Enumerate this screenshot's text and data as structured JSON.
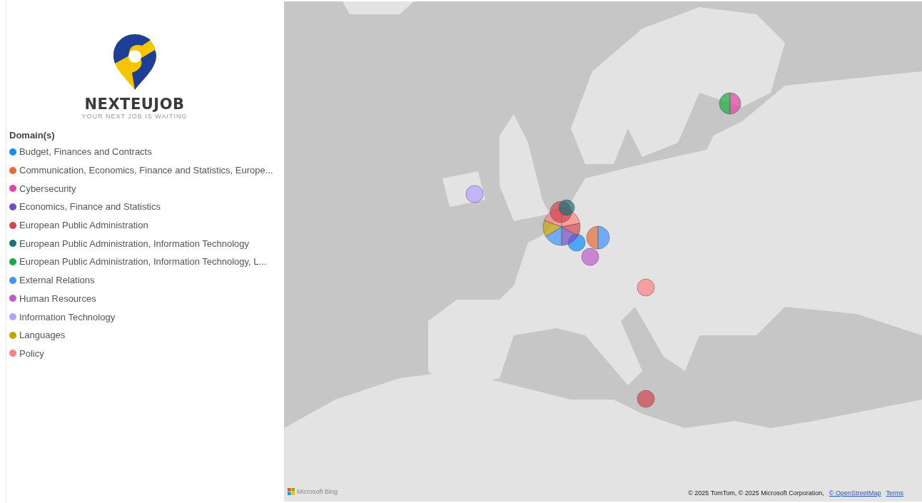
{
  "logo": {
    "name": "NEXTEUJOB",
    "tagline": "YOUR NEXT JOB IS WAITING"
  },
  "legend": {
    "title": "Domain(s)",
    "items": [
      {
        "label": "Budget, Finances and Contracts",
        "color": "#118dff"
      },
      {
        "label": "Communication, Economics, Finance and Statistics, Europe...",
        "color": "#e66c37"
      },
      {
        "label": "Cybersecurity",
        "color": "#e044a7"
      },
      {
        "label": "Economics, Finance and Statistics",
        "color": "#744ec2"
      },
      {
        "label": "European Public Administration",
        "color": "#d64550"
      },
      {
        "label": "European Public Administration, Information Technology",
        "color": "#197278"
      },
      {
        "label": "European Public Administration, Information Technology, L...",
        "color": "#1aab40"
      },
      {
        "label": "External Relations",
        "color": "#4092ff"
      },
      {
        "label": "Human Resources",
        "color": "#be5dc9"
      },
      {
        "label": "Information Technology",
        "color": "#b5a1ff"
      },
      {
        "label": "Languages",
        "color": "#c4a200"
      },
      {
        "label": "Policy",
        "color": "#ff8080"
      }
    ]
  },
  "map": {
    "kind": "picture",
    "provider": "Microsoft Bing",
    "attribution": "© 2025 TomTom, © 2025 Microsoft Corporation,",
    "links": [
      "© OpenStreetMap",
      "Terms"
    ]
  }
}
